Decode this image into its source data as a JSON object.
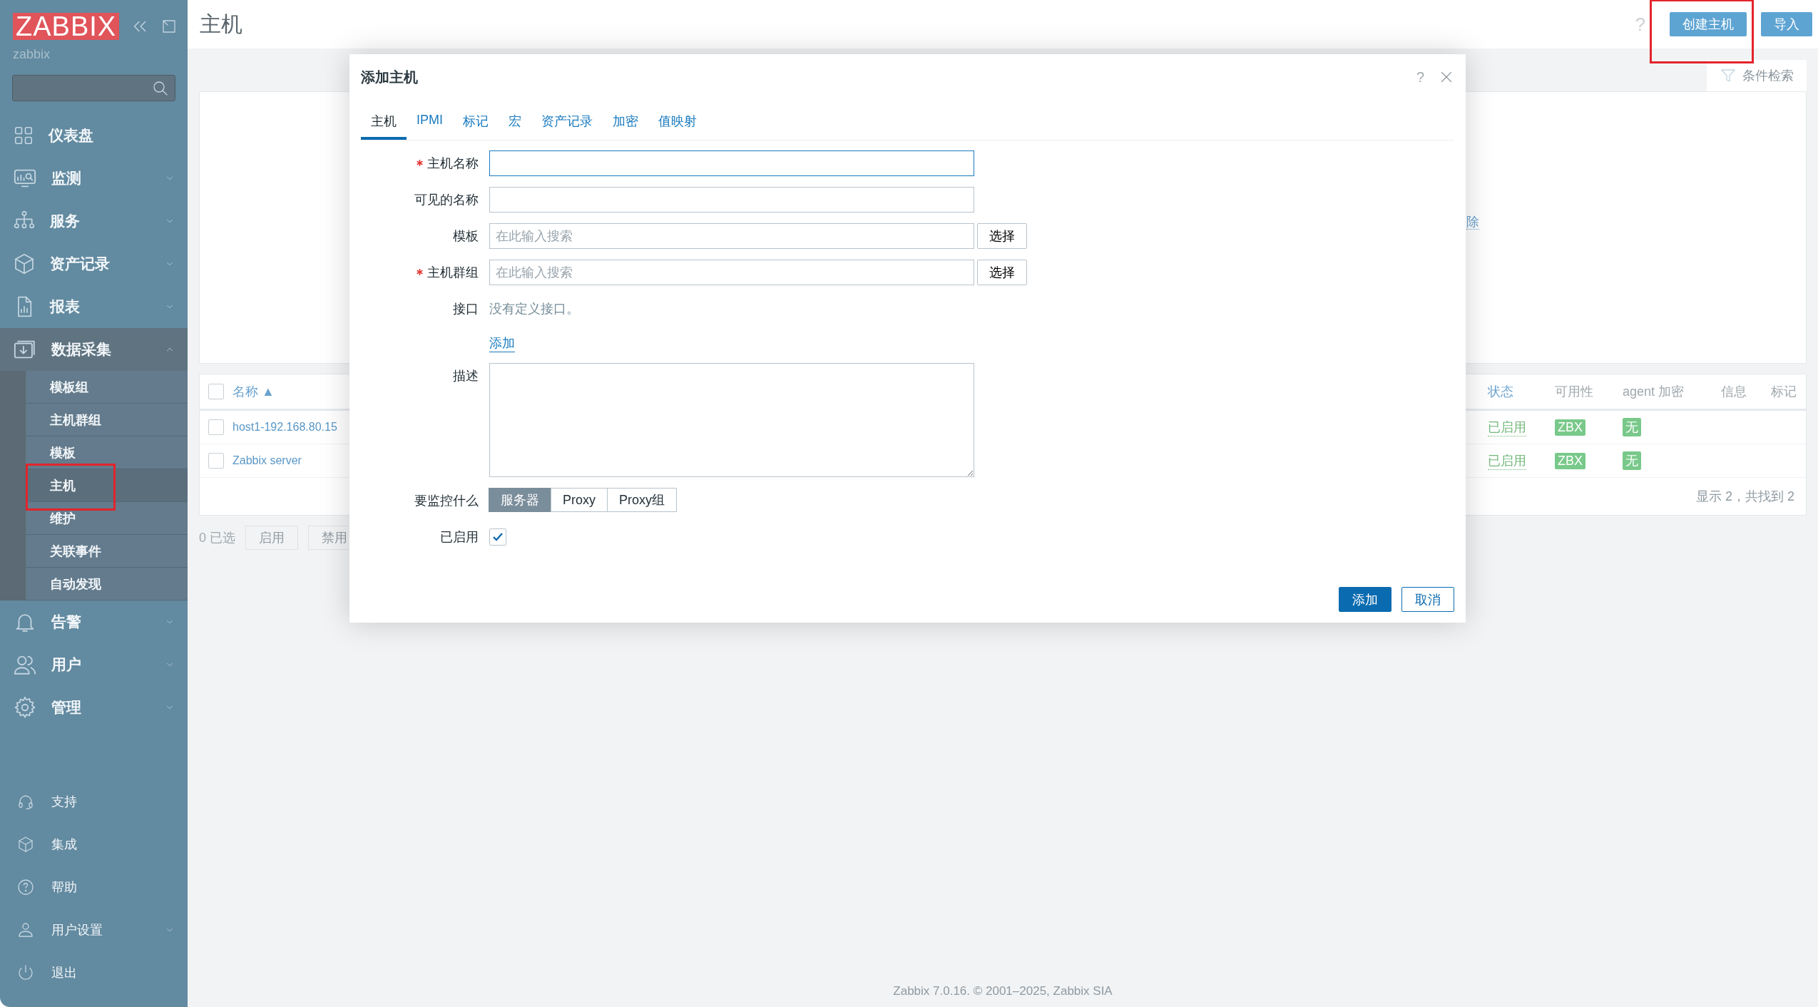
{
  "sidebar": {
    "logo": "ZABBIX",
    "server_name": "zabbix",
    "menu": [
      {
        "label": "仪表盘",
        "kind": "link"
      },
      {
        "label": "监测",
        "kind": "group",
        "expanded": false
      },
      {
        "label": "服务",
        "kind": "group",
        "expanded": false
      },
      {
        "label": "资产记录",
        "kind": "group",
        "expanded": false
      },
      {
        "label": "报表",
        "kind": "group",
        "expanded": false
      },
      {
        "label": "数据采集",
        "kind": "group",
        "expanded": true,
        "children": [
          {
            "label": "模板组",
            "selected": false,
            "annotated": false
          },
          {
            "label": "主机群组",
            "selected": false,
            "annotated": false
          },
          {
            "label": "模板",
            "selected": false,
            "annotated": false
          },
          {
            "label": "主机",
            "selected": true,
            "annotated": true
          },
          {
            "label": "维护",
            "selected": false,
            "annotated": false
          },
          {
            "label": "关联事件",
            "selected": false,
            "annotated": false
          },
          {
            "label": "自动发现",
            "selected": false,
            "annotated": false
          }
        ]
      },
      {
        "label": "告警",
        "kind": "group",
        "expanded": false
      },
      {
        "label": "用户",
        "kind": "group",
        "expanded": false
      },
      {
        "label": "管理",
        "kind": "group",
        "expanded": false
      }
    ],
    "user_menu": [
      {
        "label": "支持",
        "kind": "link"
      },
      {
        "label": "集成",
        "kind": "link"
      },
      {
        "label": "帮助",
        "kind": "link"
      },
      {
        "label": "用户设置",
        "kind": "group",
        "expanded": false
      },
      {
        "label": "退出",
        "kind": "link"
      }
    ]
  },
  "header": {
    "title": "主机",
    "help": "?",
    "buttons": [
      {
        "label": "创建主机",
        "annotated": true
      },
      {
        "label": "导入",
        "annotated": false
      }
    ]
  },
  "filter": {
    "tab": "条件检索",
    "link": "除"
  },
  "table": {
    "all_checked": false,
    "columns": [
      "名称 ▲",
      "状态",
      "可用性",
      "agent 加密",
      "信息",
      "标记"
    ],
    "rows": [
      {
        "name": "host1-192.168.80.15",
        "status": "已启用",
        "availability": "ZBX",
        "encryption": "无",
        "checked": false
      },
      {
        "name": "Zabbix server",
        "status": "已启用",
        "availability": "ZBX",
        "encryption": "无",
        "checked": false
      }
    ],
    "count": "显示 2，共找到 2",
    "selected_count": "0 已选",
    "actions": [
      "启用",
      "禁用"
    ]
  },
  "dialog": {
    "title": "添加主机",
    "help": "?",
    "tabs": [
      {
        "label": "主机",
        "selected": true
      },
      {
        "label": "IPMI",
        "selected": false
      },
      {
        "label": "标记",
        "selected": false
      },
      {
        "label": "宏",
        "selected": false
      },
      {
        "label": "资产记录",
        "selected": false
      },
      {
        "label": "加密",
        "selected": false
      },
      {
        "label": "值映射",
        "selected": false
      }
    ],
    "fields": [
      {
        "kind": "text",
        "label": "主机名称",
        "required": true,
        "focused": true
      },
      {
        "kind": "text",
        "label": "可见的名称",
        "required": false,
        "focused": false
      },
      {
        "kind": "multiselect",
        "label": "模板",
        "required": false,
        "placeholder": "在此输入搜索",
        "button": "选择"
      },
      {
        "kind": "multiselect",
        "label": "主机群组",
        "required": true,
        "placeholder": "在此输入搜索",
        "button": "选择"
      },
      {
        "kind": "static",
        "label": "接口",
        "text": "没有定义接口。",
        "link": "添加"
      },
      {
        "kind": "textarea",
        "label": "描述"
      },
      {
        "kind": "segmented",
        "label": "要监控什么",
        "options": [
          {
            "label": "服务器",
            "selected": true
          },
          {
            "label": "Proxy",
            "selected": false
          },
          {
            "label": "Proxy组",
            "selected": false
          }
        ]
      },
      {
        "kind": "checkbox",
        "label": "已启用",
        "checked": true
      }
    ],
    "buttons": [
      {
        "label": "添加",
        "primary": true
      },
      {
        "label": "取消",
        "primary": false
      }
    ]
  },
  "footer": "Zabbix 7.0.16. © 2001–2025, Zabbix SIA"
}
